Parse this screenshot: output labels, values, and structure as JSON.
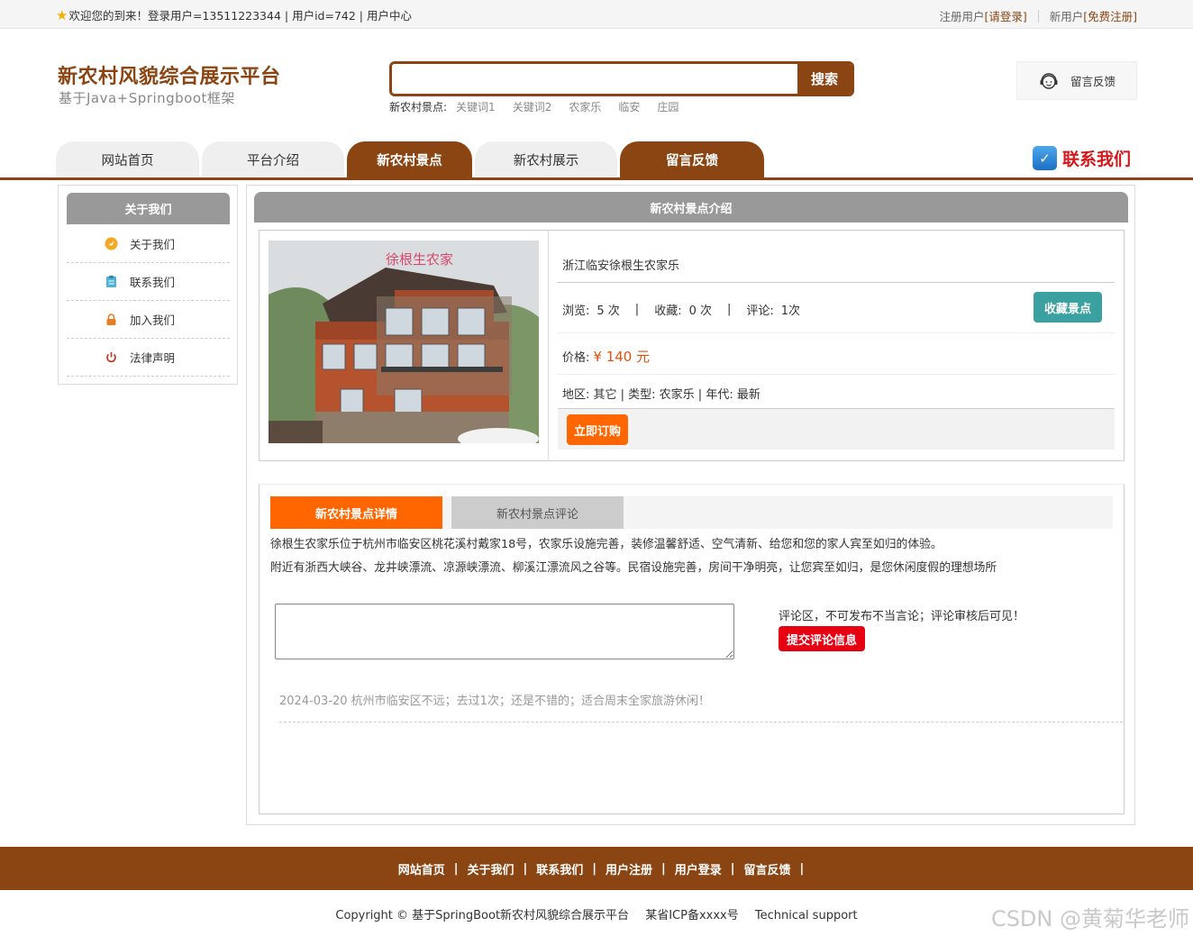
{
  "topbar": {
    "welcome": "欢迎您的到来！登录用户=13511223344 | 用户id=742 | 用户中心",
    "register_label": "注册用户",
    "login_link": "[请登录]",
    "new_user_label": "新用户",
    "signup_link": "[免费注册]"
  },
  "header": {
    "title": "新农村风貌综合展示平台",
    "subtitle": "基于Java+Springboot框架",
    "search_button": "搜索",
    "search_placeholder": "",
    "hot_label": "新农村景点:",
    "hot_words": [
      "关键词1",
      "关键词2",
      "农家乐",
      "临安",
      "庄园"
    ],
    "feedback": "留言反馈"
  },
  "nav": {
    "items": [
      {
        "label": "网站首页"
      },
      {
        "label": "平台介绍"
      },
      {
        "label": "新农村景点"
      },
      {
        "label": "新农村展示"
      },
      {
        "label": "留言反馈"
      }
    ],
    "contact": "联系我们"
  },
  "sidebar": {
    "title": "关于我们",
    "items": [
      {
        "label": "关于我们",
        "icon": "info-circle-icon"
      },
      {
        "label": "联系我们",
        "icon": "clipboard-icon"
      },
      {
        "label": "加入我们",
        "icon": "lock-icon"
      },
      {
        "label": "法律声明",
        "icon": "power-icon"
      }
    ]
  },
  "main": {
    "title": "新农村景点介绍",
    "spot_name": "浙江临安徐根生农家乐",
    "views_label": "浏览:",
    "views": "5 次",
    "favorites_label": "收藏:",
    "favorites": "0 次",
    "comments_label": "评论:",
    "comments": "1次",
    "favorite_button": "收藏景点",
    "price_label": "价格:",
    "price": "¥ 140 元",
    "region_line": "地区: 其它 | 类型: 农家乐 | 年代: 最新",
    "buy_button": "立即订购",
    "photo_sign": "徐根生农家",
    "tabs": [
      "新农村景点详情",
      "新农村景点评论"
    ],
    "desc_1": "徐根生农家乐位于杭州市临安区桃花溪村戴家18号，农家乐设施完善，装修温馨舒适、空气清新、给您和您的家人宾至如归的体验。",
    "desc_2": "附近有浙西大峡谷、龙井峡漂流、凉源峡漂流、柳溪江漂流风之谷等。民宿设施完善，房间干净明亮，让您宾至如归，是您休闲度假的理想场所",
    "comment_note": "评论区，不可发布不当言论；评论审核后可见！",
    "submit_button": "提交评论信息",
    "comment_entry": "2024-03-20 杭州市临安区不远；去过1次；还是不错的；适合周末全家旅游休闲！"
  },
  "footer": {
    "links": [
      "网站首页",
      "关于我们",
      "联系我们",
      "用户注册",
      "用户登录",
      "留言反馈"
    ],
    "separator": "|",
    "copyright": "Copyright © 基于SpringBoot新农村风貌综合展示平台",
    "icp": "某省ICP备xxxx号",
    "support": "Technical support",
    "watermark": "CSDN @黄菊华老师"
  },
  "colors": {
    "brand": "#8b4513",
    "accent_orange": "#ff6600",
    "teal": "#3aa0a0",
    "red": "#e60012"
  }
}
